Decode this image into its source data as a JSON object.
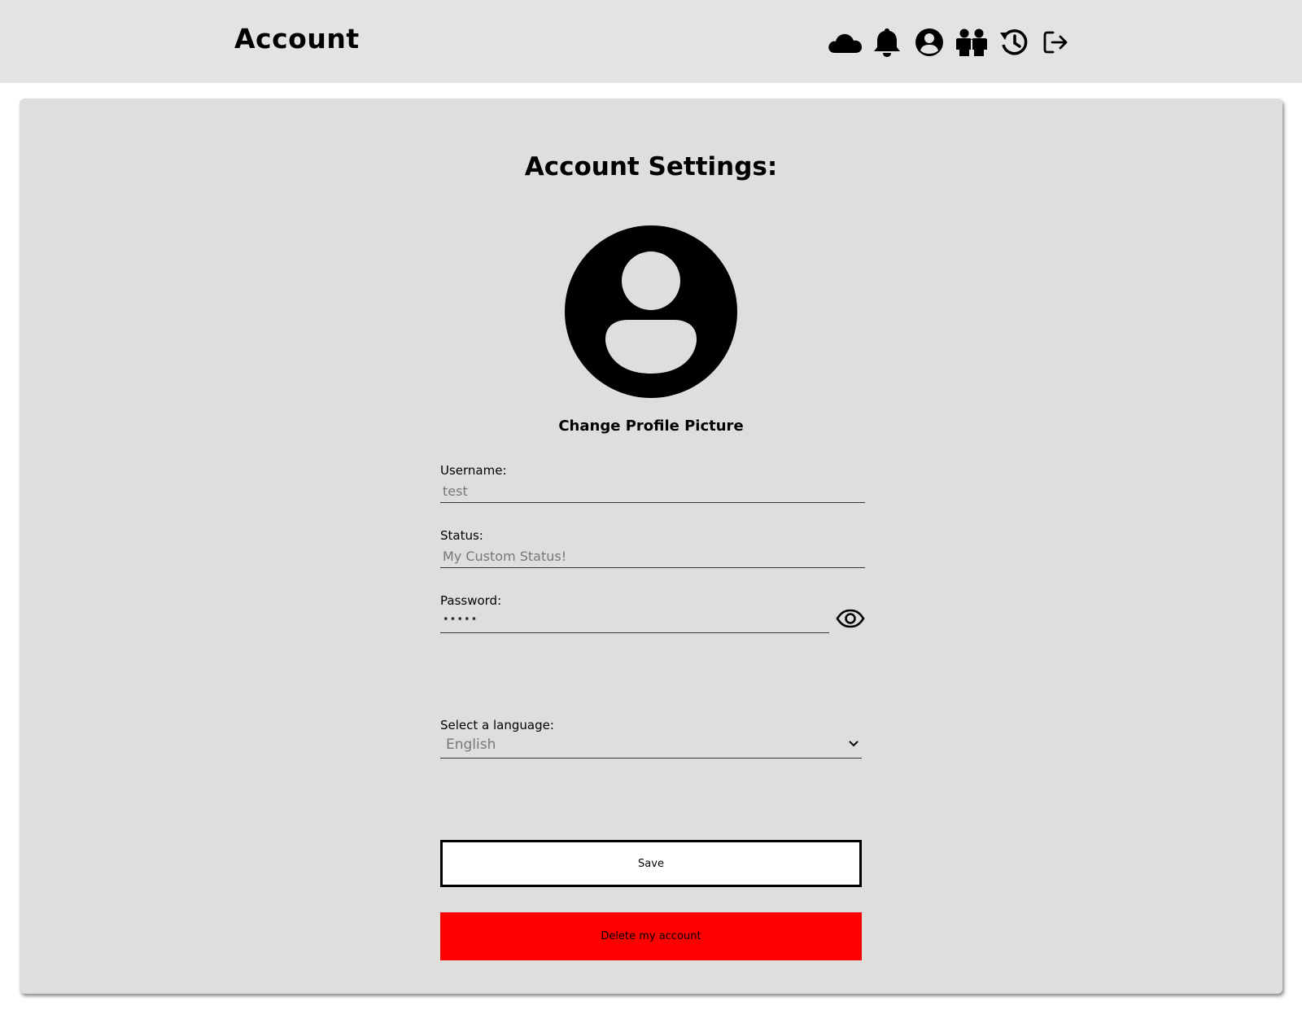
{
  "header": {
    "title": "Account",
    "icons": [
      "cloud-icon",
      "bell-icon",
      "user-circle-icon",
      "friends-icon",
      "history-icon",
      "logout-icon"
    ]
  },
  "settings": {
    "heading": "Account Settings:",
    "change_picture_label": "Change Profile Picture",
    "username": {
      "label": "Username:",
      "value": "test"
    },
    "status": {
      "label": "Status:",
      "value": "My Custom Status!"
    },
    "password": {
      "label": "Password:",
      "value": "•••••"
    },
    "language": {
      "label": "Select a language:",
      "selected": "English"
    },
    "save_label": "Save",
    "delete_label": "Delete my account"
  },
  "colors": {
    "header_bg": "#e3e3e3",
    "card_bg": "#e0dddd",
    "delete_button": "#ff0000"
  }
}
